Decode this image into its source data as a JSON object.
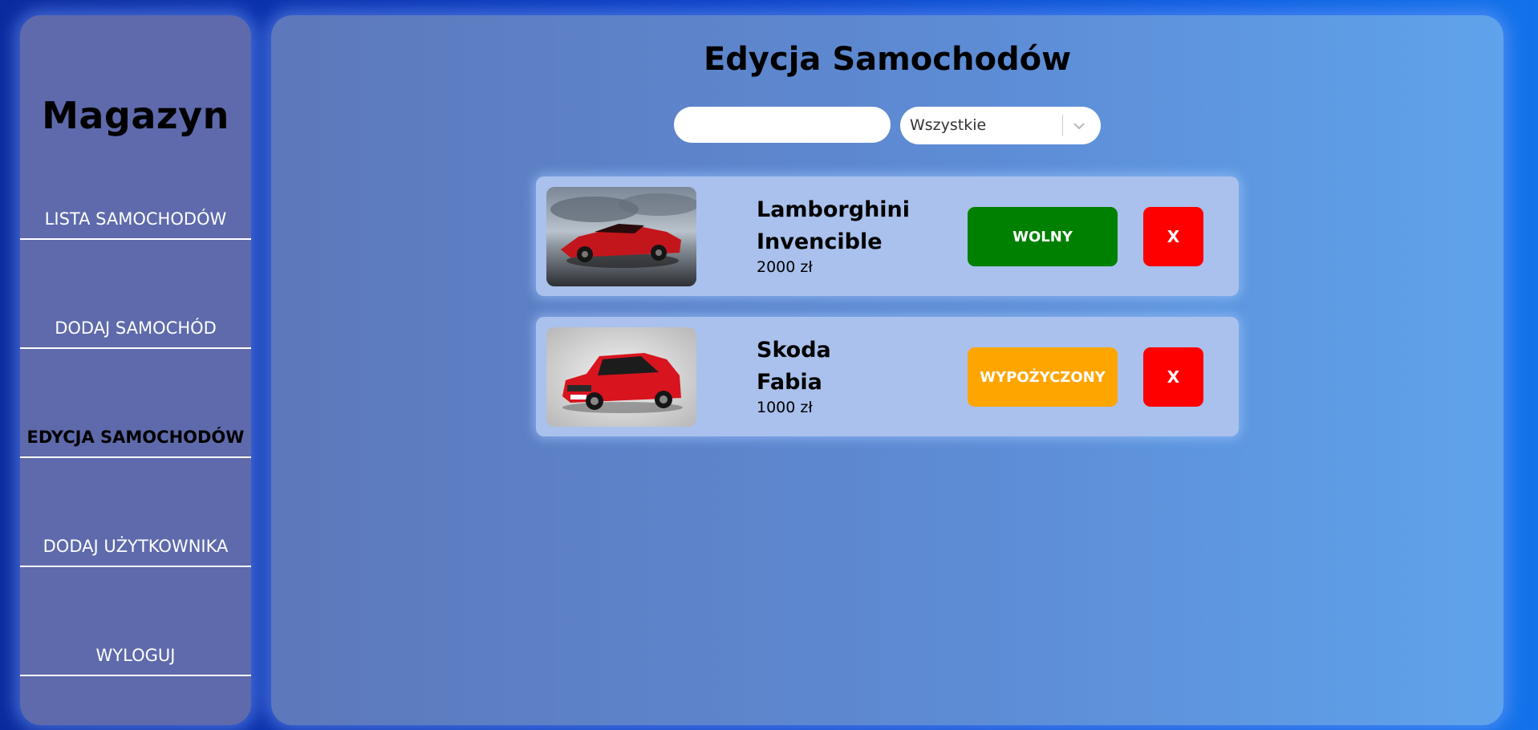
{
  "sidebar": {
    "logo": "Magazyn",
    "items": [
      {
        "label": "LISTA SAMOCHODÓW",
        "active": false
      },
      {
        "label": "DODAJ SAMOCHÓD",
        "active": false
      },
      {
        "label": "EDYCJA SAMOCHODÓW",
        "active": true
      },
      {
        "label": "DODAJ UŻYTKOWNIKA",
        "active": false
      },
      {
        "label": "WYLOGUJ",
        "active": false
      }
    ]
  },
  "main": {
    "title": "Edycja Samochodów",
    "search": {
      "value": "",
      "placeholder": ""
    },
    "filter": {
      "selected": "Wszystkie"
    },
    "cars": [
      {
        "brand": "Lamborghini",
        "model": "Invencible",
        "price": "2000 zł",
        "status": "WOLNY",
        "status_color": "#008000",
        "delete_label": "X"
      },
      {
        "brand": "Skoda",
        "model": "Fabia",
        "price": "1000 zł",
        "status": "WYPOŻYCZONY",
        "status_color": "#ffa500",
        "delete_label": "X"
      }
    ]
  },
  "colors": {
    "accent_delete": "#ff0000",
    "card_bg": "#a9c1ec"
  }
}
